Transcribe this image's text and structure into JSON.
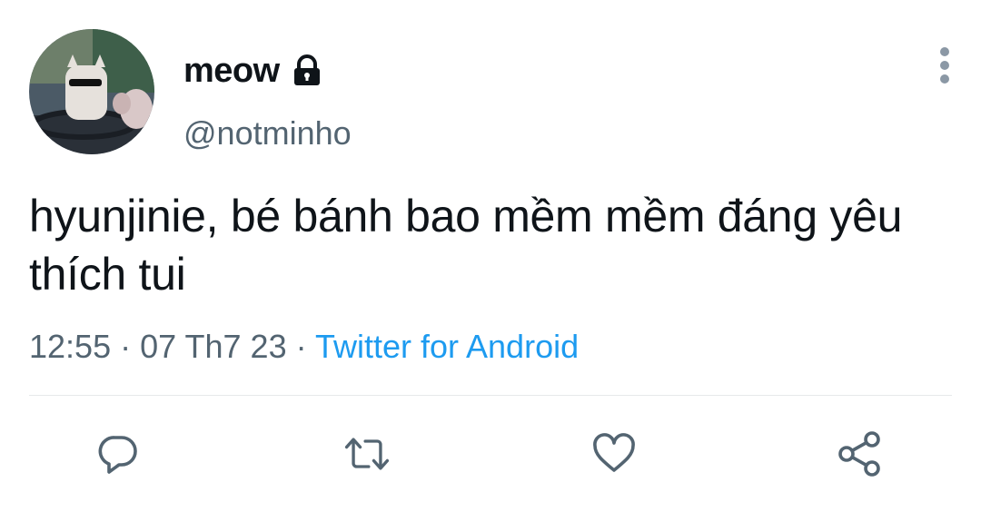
{
  "tweet": {
    "author": {
      "display_name": "meow",
      "handle": "@notminho",
      "protected_icon": "lock-icon"
    },
    "text": "hyunjinie, bé bánh bao mềm mềm đáng yêu thích tui",
    "time": "12:55",
    "separator": "·",
    "date": "07 Th7 23",
    "source": "Twitter for Android"
  },
  "actions": {
    "reply_icon": "reply-icon",
    "retweet_icon": "retweet-icon",
    "like_icon": "heart-icon",
    "share_icon": "share-icon",
    "more_icon": "more-vertical-icon"
  },
  "colors": {
    "text": "#0f1419",
    "secondary": "#536471",
    "link": "#1d9bf0",
    "divider": "#e7e9ea"
  }
}
